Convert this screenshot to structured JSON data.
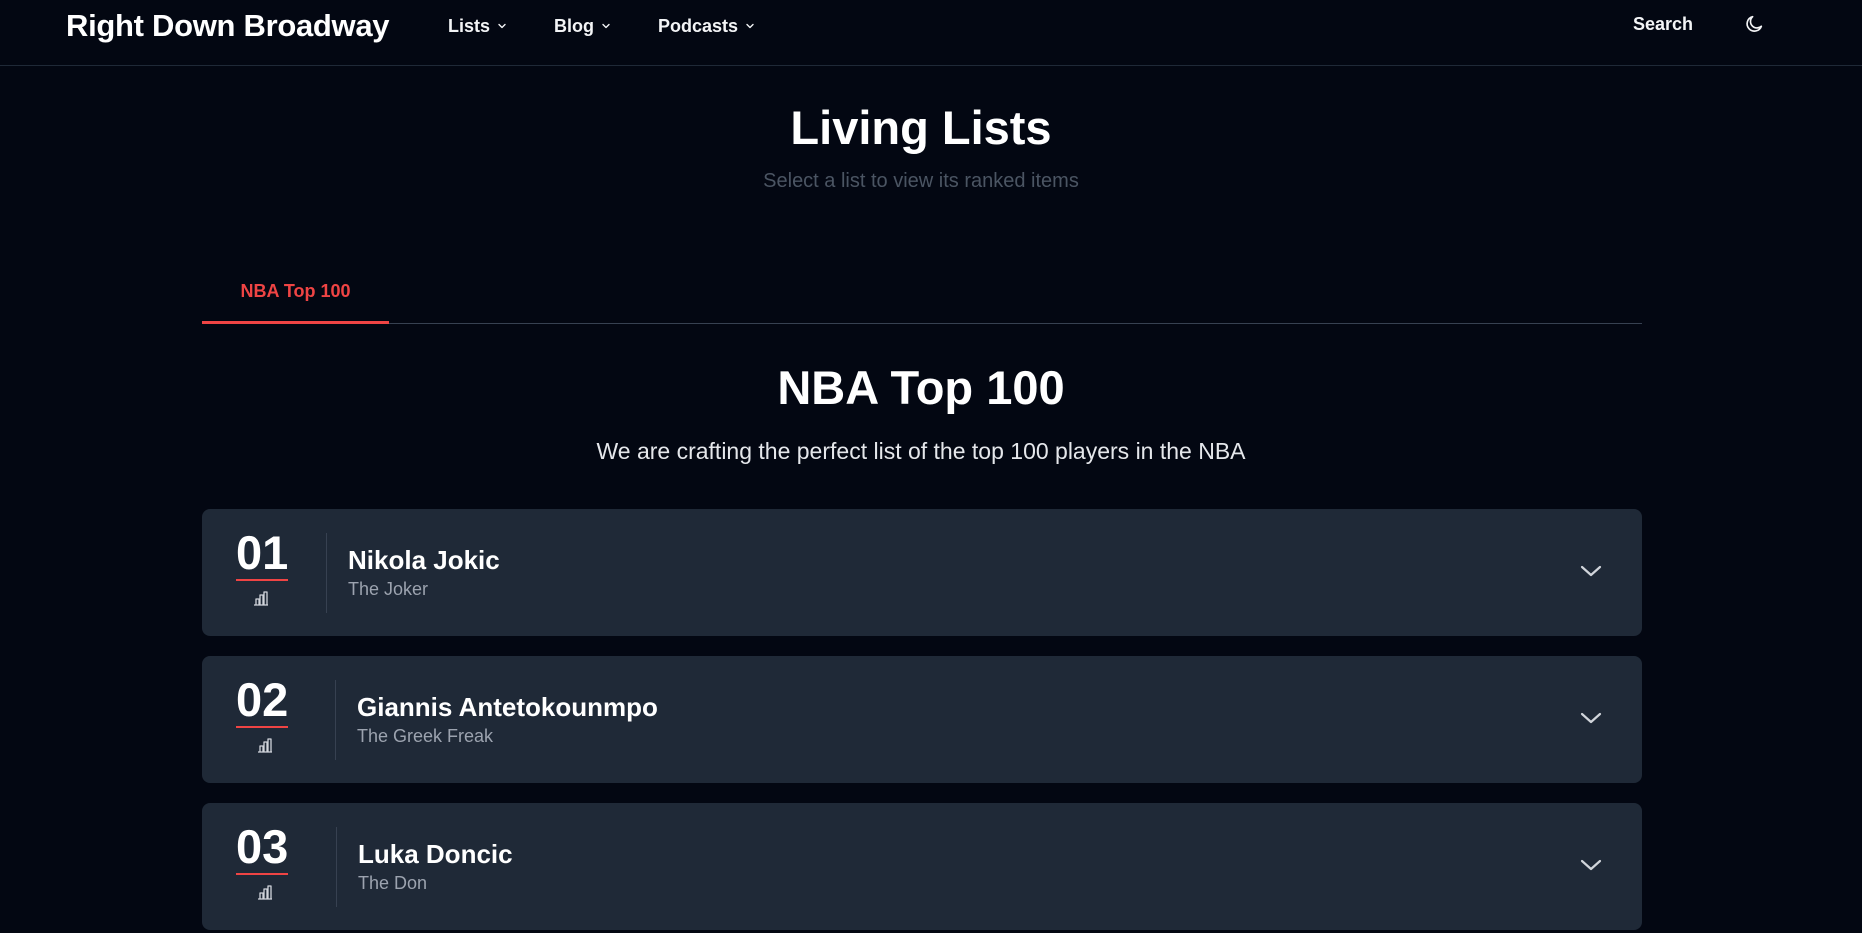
{
  "navbar": {
    "brand": "Right Down Broadway",
    "menu": [
      {
        "label": "Lists"
      },
      {
        "label": "Blog"
      },
      {
        "label": "Podcasts"
      }
    ],
    "search_label": "Search",
    "theme_icon": "moon-icon"
  },
  "header": {
    "title": "Living Lists",
    "subtitle": "Select a list to view its ranked items"
  },
  "tabs": [
    {
      "label": "NBA Top 100",
      "active": true
    }
  ],
  "list": {
    "title": "NBA Top 100",
    "description": "We are crafting the perfect list of the top 100 players in the NBA",
    "items": [
      {
        "rank": "01",
        "name": "Nikola Jokic",
        "nickname": "The Joker"
      },
      {
        "rank": "02",
        "name": "Giannis Antetokounmpo",
        "nickname": "The Greek Freak"
      },
      {
        "rank": "03",
        "name": "Luka Doncic",
        "nickname": "The Don"
      }
    ]
  },
  "colors": {
    "background": "#030712",
    "card": "#1f2937",
    "accent": "#ef4444",
    "muted_text": "#9ca3af"
  }
}
